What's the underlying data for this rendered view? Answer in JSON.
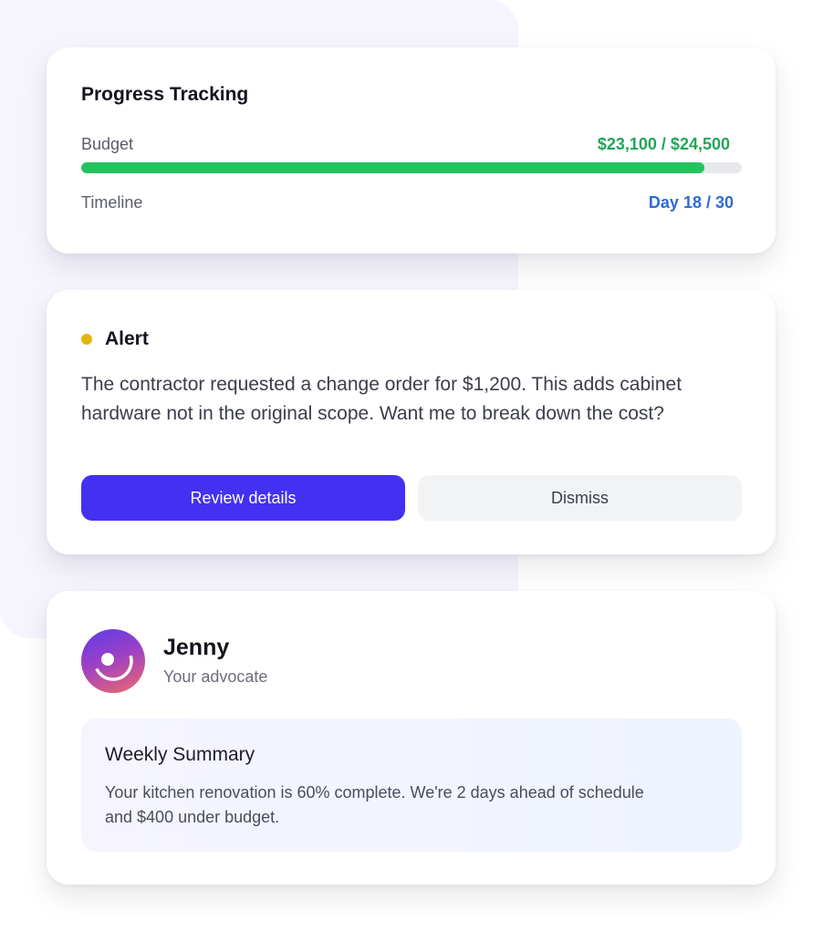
{
  "progress": {
    "title": "Progress Tracking",
    "budget_label": "Budget",
    "budget_value": "$23,100 / $24,500",
    "budget_fraction": 0.943,
    "timeline_label": "Timeline",
    "timeline_value": "Day 18 / 30"
  },
  "alert": {
    "title": "Alert",
    "body": "The contractor requested a change order for $1,200. This adds cabinet hardware not in the original scope. Want me to break down the cost?",
    "primary_button": "Review details",
    "secondary_button": "Dismiss"
  },
  "advocate": {
    "name": "Jenny",
    "role": "Your advocate",
    "summary_title": "Weekly Summary",
    "summary_text": "Your kitchen renovation is 60% complete. We're 2 days ahead of schedule and $400 under budget."
  },
  "colors": {
    "budget_green": "#22c35e",
    "timeline_blue": "#2f6bd6",
    "alert_yellow": "#e5b40f",
    "primary_button": "#4430f0"
  }
}
